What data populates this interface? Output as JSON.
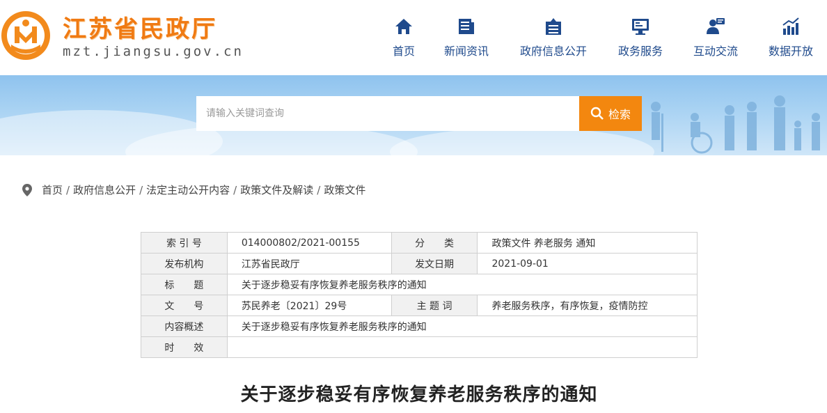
{
  "header": {
    "site_title": "江苏省民政厅",
    "site_url": "mzt.jiangsu.gov.cn"
  },
  "nav": [
    {
      "label": "首页",
      "icon": "home-icon"
    },
    {
      "label": "新闻资讯",
      "icon": "news-icon"
    },
    {
      "label": "政府信息公开",
      "icon": "archive-icon"
    },
    {
      "label": "政务服务",
      "icon": "monitor-icon"
    },
    {
      "label": "互动交流",
      "icon": "user-chat-icon"
    },
    {
      "label": "数据开放",
      "icon": "bar-chart-icon"
    }
  ],
  "search": {
    "placeholder": "请输入关键词查询",
    "button_label": "检索"
  },
  "breadcrumb": {
    "items": [
      "首页",
      "政府信息公开",
      "法定主动公开内容",
      "政策文件及解读",
      "政策文件"
    ],
    "separator": "/"
  },
  "meta": {
    "index_label": "索 引 号",
    "index_value": "014000802/2021-00155",
    "category_label": "分　　类",
    "category_value": "政策文件 养老服务 通知",
    "issuer_label": "发布机构",
    "issuer_value": "江苏省民政厅",
    "date_label": "发文日期",
    "date_value": "2021-09-01",
    "title_label": "标　　题",
    "title_value": "关于逐步稳妥有序恢复养老服务秩序的通知",
    "docno_label": "文　　号",
    "docno_value": "苏民养老〔2021〕29号",
    "subject_label": "主 题 词",
    "subject_value": "养老服务秩序，有序恢复，疫情防控",
    "summary_label": "内容概述",
    "summary_value": "关于逐步稳妥有序恢复养老服务秩序的通知",
    "validity_label": "时　　效",
    "validity_value": ""
  },
  "document": {
    "title": "关于逐步稳妥有序恢复养老服务秩序的通知"
  },
  "colors": {
    "brand_orange": "#f07a12",
    "nav_blue": "#1f4a8c",
    "search_button": "#f3870f",
    "banner_blue": "#9ccaf0"
  }
}
